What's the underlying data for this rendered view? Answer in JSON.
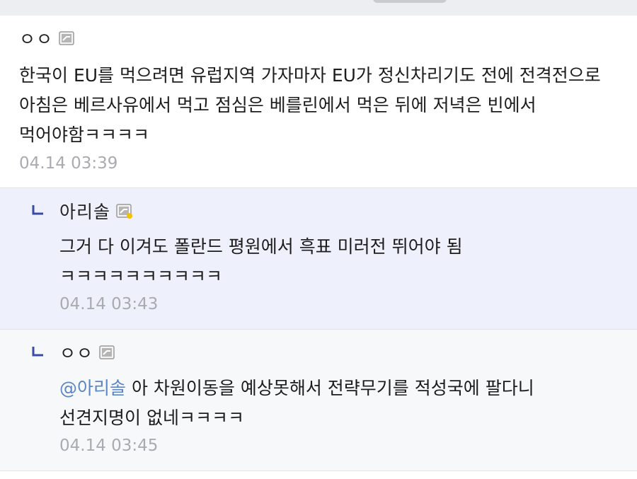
{
  "comments": [
    {
      "nickname": "ㅇㅇ",
      "level_icon": "gray-member-icon",
      "text": "한국이 EU를 먹으려면 유럽지역 가자마자 EU가 정신차리기도 전에 전격전으로 아침은 베르사유에서 먹고 점심은 베를린에서 먹은 뒤에 저녁은 빈에서 먹어야함ㅋㅋㅋㅋ",
      "time": "04.14 03:39"
    }
  ],
  "replies": [
    {
      "nickname": "아리솔",
      "level_icon": "fixed-member-icon",
      "text": "그거 다 이겨도 폴란드 평원에서 흑표 미러전 뛰어야 됨 ㅋㅋㅋㅋㅋㅋㅋㅋㅋㅋ",
      "time": "04.14 03:43"
    },
    {
      "nickname": "ㅇㅇ",
      "level_icon": "gray-member-icon",
      "mention": "@아리솔",
      "text": " 아 차원이동을 예상못해서 전략무기를 적성국에 팔다니 선견지명이 없네ㅋㅋㅋㅋ",
      "time": "04.14 03:45"
    }
  ],
  "colors": {
    "reply_highlight_bg": "#eef0fb",
    "mention": "#5b86c6",
    "time": "#a9abb0",
    "reply_arrow": "#3a4aa6"
  }
}
